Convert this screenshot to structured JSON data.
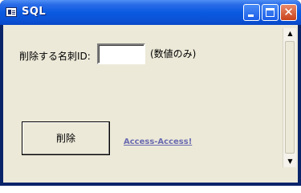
{
  "window": {
    "title": "SQL",
    "icon": "form-icon",
    "controls": {
      "minimize": "minimize-icon",
      "maximize": "maximize-icon",
      "close_glyph": "✕"
    }
  },
  "form": {
    "id_label": "削除する名刺ID:",
    "id_value": "",
    "hint": "(数値のみ)",
    "delete_button_label": "削除",
    "link_text": "Access-Access!"
  },
  "scrollbar": {
    "up_arrow": "▲",
    "down_arrow": "▼"
  },
  "colors": {
    "titlebar": "#0a5ae0",
    "client_background": "#ece9d8",
    "close_button": "#c8421c",
    "link": "#6a6ab0"
  }
}
